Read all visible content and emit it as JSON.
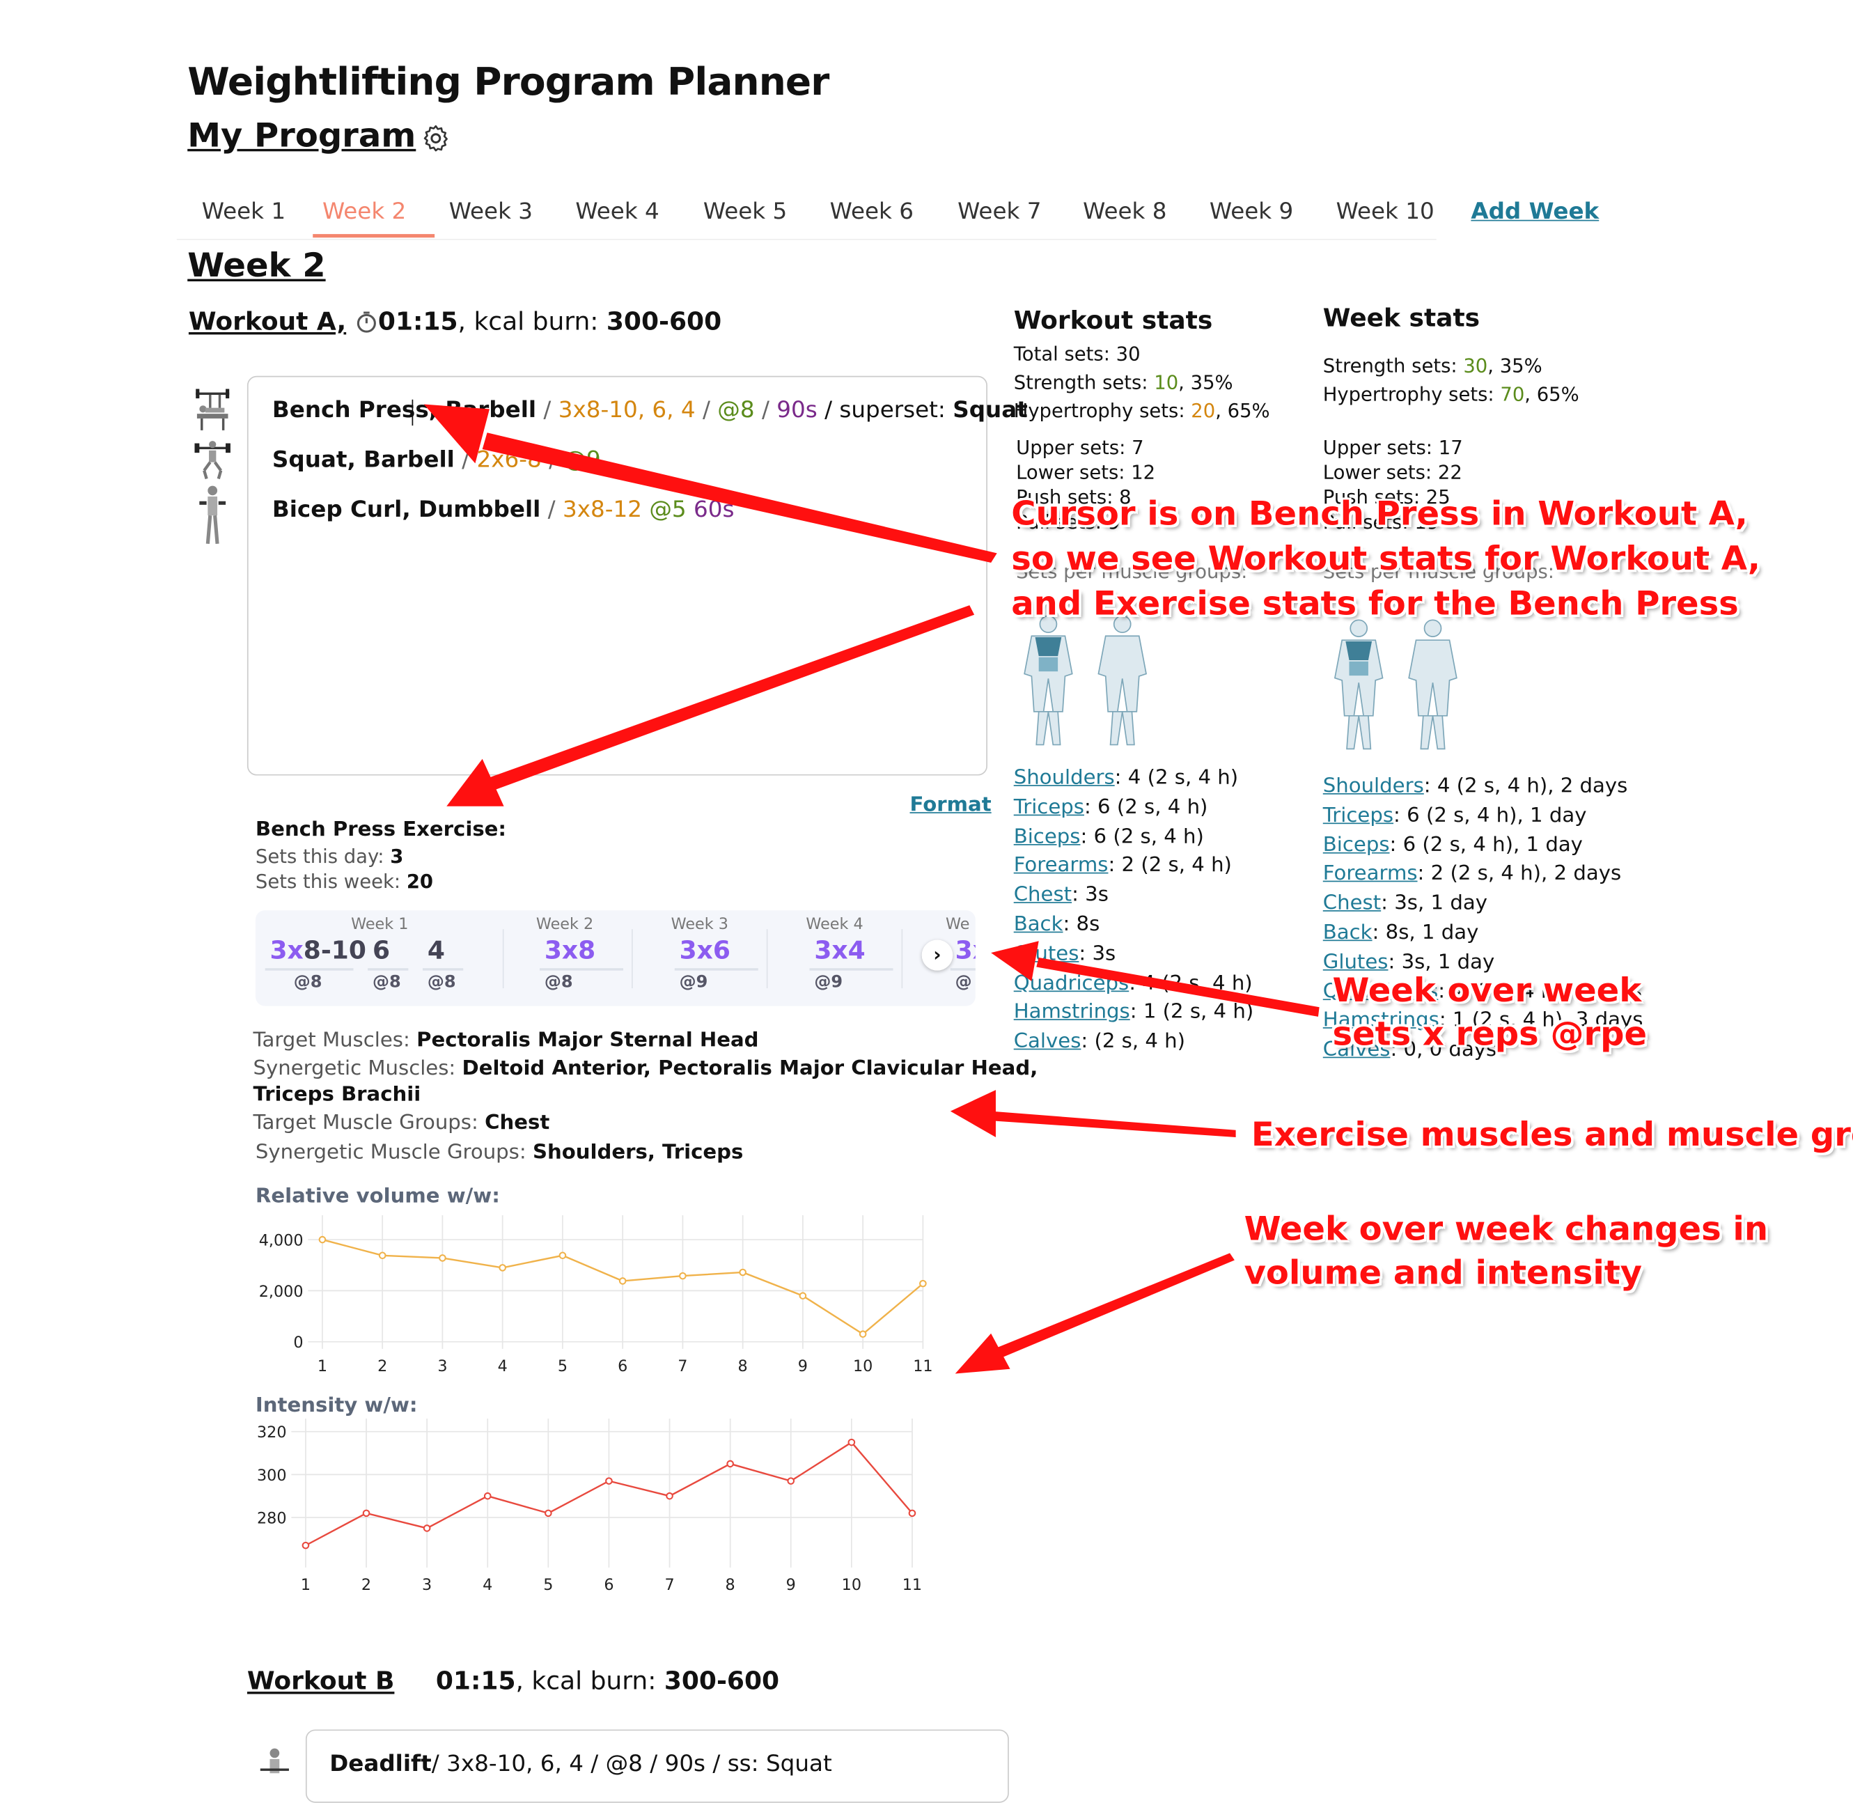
{
  "app": {
    "title": "Weightlifting Program Planner",
    "program_name": "My Program",
    "settings_icon": "gear-icon"
  },
  "tabs": [
    "Week 1",
    "Week 2",
    "Week 3",
    "Week 4",
    "Week 5",
    "Week 6",
    "Week 7",
    "Week 8",
    "Week 9",
    "Week 10"
  ],
  "active_tab": "Week 2",
  "add_week_label": "Add Week",
  "week_heading": "Week 2",
  "workout_a": {
    "name": "Workout A,",
    "timer_icon": "stopwatch-icon",
    "duration": "01:15",
    "kcal_label": ", kcal burn: ",
    "kcal": "300-600"
  },
  "exercises": [
    {
      "name": "Bench Press, Barbell",
      "sep1": " / ",
      "sets": "3x8-10, 6, 4",
      "sep2": " / ",
      "rpe": "@8",
      "sep3": " / ",
      "rest": "90s",
      "sep4": " / superset: ",
      "superset": "Squat",
      "thumb": "bench-press-thumbnail"
    },
    {
      "name": "Squat, Barbell",
      "sep1": " / ",
      "sets": "2x6-8",
      "sep2": " / ",
      "rpe": "@9",
      "thumb": "squat-thumbnail"
    },
    {
      "name": "Bicep Curl, Dumbbell",
      "sep1": " / ",
      "sets": "3x8-12",
      "rpe": " @5",
      "rest": " 60s",
      "thumb": "bicep-curl-thumbnail"
    }
  ],
  "format_label": "Format",
  "exercise_stats": {
    "title": "Bench Press Exercise:",
    "sets_day_label": "Sets this day: ",
    "sets_day": "3",
    "sets_week_label": "Sets this week: ",
    "sets_week": "20"
  },
  "history": [
    {
      "week": "Week 1",
      "items": [
        {
          "prefix": "3x",
          "value": "8-10",
          "rpe": "@8"
        },
        {
          "prefix": "",
          "value": "6",
          "rpe": "@8"
        },
        {
          "prefix": "",
          "value": "4",
          "rpe": "@8"
        }
      ]
    },
    {
      "week": "Week 2",
      "items": [
        {
          "prefix": "",
          "value": "3x8",
          "rpe": "@8"
        }
      ]
    },
    {
      "week": "Week 3",
      "items": [
        {
          "prefix": "",
          "value": "3x6",
          "rpe": "@9"
        }
      ]
    },
    {
      "week": "Week 4",
      "items": [
        {
          "prefix": "",
          "value": "3x4",
          "rpe": "@9"
        }
      ]
    },
    {
      "week": "We",
      "items": [
        {
          "prefix": "",
          "value": "3x",
          "rpe": "@"
        }
      ]
    }
  ],
  "history_next_label": "›",
  "muscles": {
    "target_label": "Target Muscles: ",
    "target": "Pectoralis Major Sternal Head",
    "syn_label": "Synergetic Muscles: ",
    "syn_1": "Deltoid Anterior, Pectoralis Major Clavicular Head,",
    "syn_2": "Triceps Brachii",
    "tgroup_label": "Target Muscle Groups: ",
    "tgroup": "Chest",
    "sgroup_label": "Synergetic Muscle Groups: ",
    "sgroup": "Shoulders, Triceps"
  },
  "chart_data": [
    {
      "type": "line",
      "title": "Relative volume w/w:",
      "x": [
        1,
        2,
        3,
        4,
        5,
        6,
        7,
        8,
        9,
        10,
        11
      ],
      "series": [
        {
          "values": [
            4000,
            3380,
            3280,
            2900,
            3380,
            2380,
            2580,
            2720,
            1800,
            300,
            2280
          ],
          "color": "#f0b24a"
        }
      ],
      "ylim": [
        0,
        4400
      ],
      "yticks": [
        "4,000",
        "2,000",
        "0"
      ],
      "grid": true
    },
    {
      "type": "line",
      "title": "Intensity w/w:",
      "x": [
        1,
        2,
        3,
        4,
        5,
        6,
        7,
        8,
        9,
        10,
        11
      ],
      "series": [
        {
          "values": [
            267,
            282,
            275,
            290,
            282,
            297,
            290,
            305,
            297,
            315,
            282
          ],
          "color": "#e8493e"
        }
      ],
      "ylim": [
        260,
        320
      ],
      "yticks": [
        "320",
        "300",
        "280"
      ],
      "grid": true
    }
  ],
  "workout_stats": {
    "title": "Workout stats",
    "total": "Total sets: 30",
    "strength_label": "Strength sets: ",
    "strength_n": "10",
    "strength_pct": ", 35%",
    "hyper_label": "Hypertrophy sets: ",
    "hyper_n": "20",
    "hyper_pct": ", 65%",
    "upper": "Upper sets: 7",
    "lower": "Lower sets: 12",
    "push": "Push sets: 8",
    "pull": "Pull sets: 9",
    "per_group": "Sets per muscle groups:",
    "muscles": [
      {
        "name": "Shoulders",
        "val": ": 4 (2 s, 4 h)"
      },
      {
        "name": "Triceps",
        "val": ": 6 (2 s, 4 h)"
      },
      {
        "name": "Biceps",
        "val": ": 6 (2 s, 4 h)"
      },
      {
        "name": "Forearms",
        "val": ": 2 (2 s, 4 h)"
      },
      {
        "name": "Chest",
        "val": ": 3s"
      },
      {
        "name": "Back",
        "val": ": 8s"
      },
      {
        "name": "Glutes",
        "val": ": 3s"
      },
      {
        "name": "Quadriceps",
        "val": ": 4 (2 s, 4 h)"
      },
      {
        "name": "Hamstrings",
        "val": ": 1 (2 s, 4 h)"
      },
      {
        "name": "Calves",
        "val": ":  (2 s, 4 h)"
      }
    ]
  },
  "week_stats": {
    "title": "Week stats",
    "strength_label": "Strength sets: ",
    "strength_n": "30",
    "strength_pct": ", 35%",
    "hyper_label": "Hypertrophy sets: ",
    "hyper_n": "70",
    "hyper_pct": ", 65%",
    "upper": "Upper sets: 17",
    "lower": "Lower sets: 22",
    "push": "Push sets: 25",
    "pull": "Pull sets: 19",
    "per_group": "Sets per muscle groups:",
    "muscles": [
      {
        "name": "Shoulders",
        "val": ": 4 (2 s, 4 h), 2 days"
      },
      {
        "name": "Triceps",
        "val": ": 6 (2 s, 4 h), 1 day"
      },
      {
        "name": "Biceps",
        "val": ": 6 (2 s, 4 h), 1 day"
      },
      {
        "name": "Forearms",
        "val": ": 2 (2 s, 4 h), 2 days"
      },
      {
        "name": "Chest",
        "val": ": 3s, 1 day"
      },
      {
        "name": "Back",
        "val": ": 8s, 1 day"
      },
      {
        "name": "Glutes",
        "val": ": 3s, 1 day"
      },
      {
        "name": "Quadriceps",
        "val": ": 4 (2 s, 4 h), 2 days"
      },
      {
        "name": "Hamstrings",
        "val": ": 1 (2 s, 4 h), 3 days"
      },
      {
        "name": "Calves",
        "val": ": 0, 0 days"
      }
    ]
  },
  "annotations": {
    "cursor_1": "Cursor is on Bench Press in Workout A,",
    "cursor_2": "so we see Workout stats for Workout A,",
    "cursor_3": "and Exercise stats for the Bench Press",
    "wow_1": "Week over week",
    "wow_2": "sets x reps @rpe",
    "muscles": "Exercise muscles and muscle groups",
    "changes_1": "Week over week changes in",
    "changes_2": "volume and intensity",
    "color": "#ff1010"
  },
  "workout_b": {
    "name": "Workout B",
    "duration": "01:15",
    "kcal_label": ", kcal burn: ",
    "kcal": "300-600",
    "ex_name": "Deadlift",
    "ex_rest": "/ 3x8-10, 6, 4  / @8 / 90s / ss: Squat"
  }
}
